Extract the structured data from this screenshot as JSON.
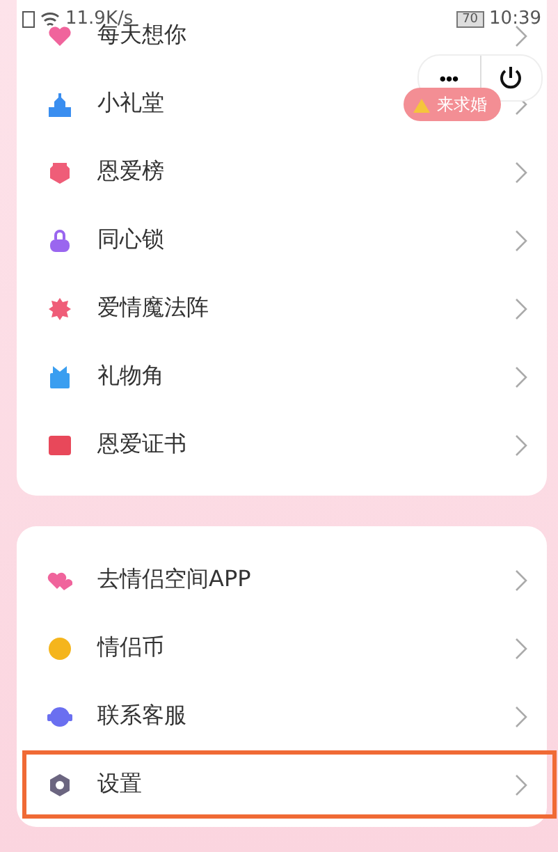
{
  "status_bar": {
    "speed": "11.9K/s",
    "battery": "70",
    "time": "10:39"
  },
  "capsule": {
    "more": "•••"
  },
  "badge": {
    "label": "来求婚"
  },
  "groups": [
    {
      "items": [
        {
          "label": "每天想你",
          "highlighted": false
        },
        {
          "label": "小礼堂",
          "highlighted": false
        },
        {
          "label": "恩爱榜",
          "highlighted": false
        },
        {
          "label": "同心锁",
          "highlighted": false
        },
        {
          "label": "爱情魔法阵",
          "highlighted": false
        },
        {
          "label": "礼物角",
          "highlighted": false
        },
        {
          "label": "恩爱证书",
          "highlighted": false
        }
      ]
    },
    {
      "items": [
        {
          "label": "去情侣空间APP",
          "highlighted": false
        },
        {
          "label": "情侣币",
          "highlighted": false
        },
        {
          "label": "联系客服",
          "highlighted": false
        },
        {
          "label": "设置",
          "highlighted": true
        }
      ]
    }
  ]
}
